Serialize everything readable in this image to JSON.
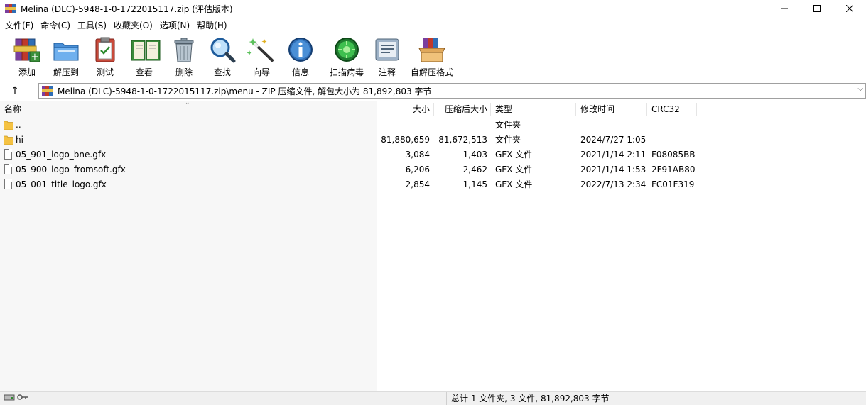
{
  "window": {
    "title": "Melina (DLC)-5948-1-0-1722015117.zip (评估版本)",
    "controls": {
      "minimize": "—",
      "maximize": "☐",
      "close": "✕"
    }
  },
  "menu": [
    "文件(F)",
    "命令(C)",
    "工具(S)",
    "收藏夹(O)",
    "选项(N)",
    "帮助(H)"
  ],
  "toolbar": [
    {
      "label": "添加",
      "icon": "add-books-icon"
    },
    {
      "label": "解压到",
      "icon": "extract-folder-icon"
    },
    {
      "label": "测试",
      "icon": "test-clipboard-icon"
    },
    {
      "label": "查看",
      "icon": "view-book-icon"
    },
    {
      "label": "删除",
      "icon": "trash-icon"
    },
    {
      "label": "查找",
      "icon": "magnifier-icon"
    },
    {
      "label": "向导",
      "icon": "wizard-wand-icon"
    },
    {
      "label": "信息",
      "icon": "info-icon"
    },
    {
      "label": "扫描病毒",
      "icon": "virus-scan-icon"
    },
    {
      "label": "注释",
      "icon": "comment-icon"
    },
    {
      "label": "自解压格式",
      "icon": "sfx-box-icon"
    }
  ],
  "address": {
    "up": "↑",
    "path": "Melina (DLC)-5948-1-0-1722015117.zip\\menu - ZIP 压缩文件, 解包大小为 81,892,803 字节",
    "dropdown": "⌵"
  },
  "columns": {
    "name": "名称",
    "size": "大小",
    "packed": "压缩后大小",
    "type": "类型",
    "modified": "修改时间",
    "crc": "CRC32"
  },
  "rows": [
    {
      "name": "..",
      "size": "",
      "packed": "",
      "type": "文件夹",
      "modified": "",
      "crc": "",
      "kind": "folder"
    },
    {
      "name": "hi",
      "size": "81,880,659",
      "packed": "81,672,513",
      "type": "文件夹",
      "modified": "2024/7/27 1:05",
      "crc": "",
      "kind": "folder"
    },
    {
      "name": "05_901_logo_bne.gfx",
      "size": "3,084",
      "packed": "1,403",
      "type": "GFX 文件",
      "modified": "2021/1/14 2:11",
      "crc": "F08085BB",
      "kind": "file"
    },
    {
      "name": "05_900_logo_fromsoft.gfx",
      "size": "6,206",
      "packed": "2,462",
      "type": "GFX 文件",
      "modified": "2021/1/14 1:53",
      "crc": "2F91AB80",
      "kind": "file"
    },
    {
      "name": "05_001_title_logo.gfx",
      "size": "2,854",
      "packed": "1,145",
      "type": "GFX 文件",
      "modified": "2022/7/13 2:34",
      "crc": "FC01F319",
      "kind": "file"
    }
  ],
  "status": {
    "text": "总计 1 文件夹, 3 文件, 81,892,803 字节",
    "icons": [
      "drive-icon",
      "key-icon"
    ]
  },
  "colors": {
    "folder": "#f5c242",
    "accent": "#0078d7"
  }
}
